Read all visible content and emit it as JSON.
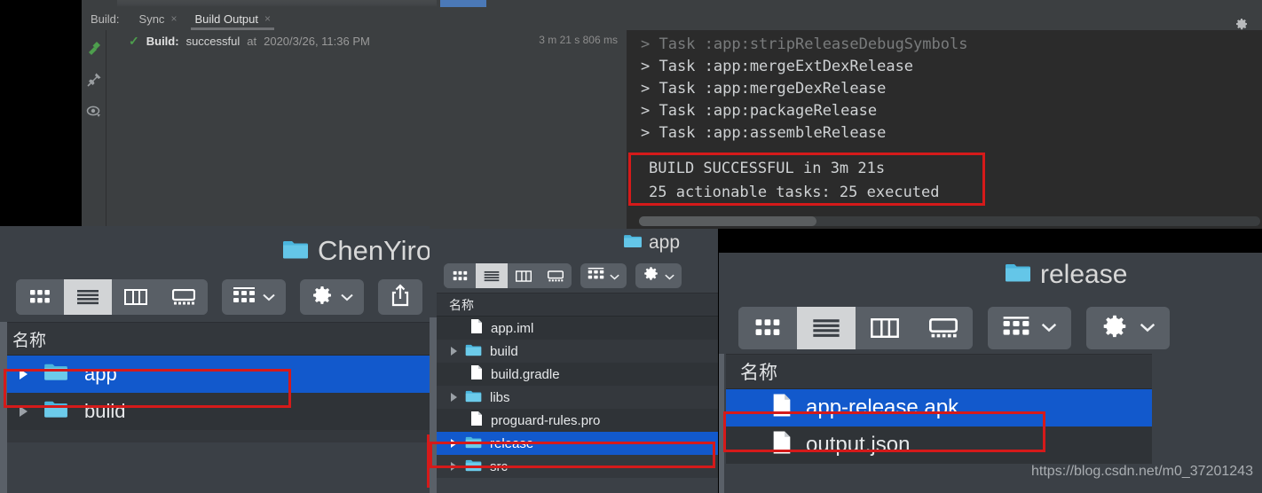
{
  "ide": {
    "tab_group_label": "Build:",
    "tabs": [
      {
        "label": "Sync",
        "close": "×",
        "active": false
      },
      {
        "label": "Build Output",
        "close": "×",
        "active": true
      }
    ],
    "settings_icon": "gear-icon",
    "rail_icons": [
      "restart-hammer-icon",
      "pin-icon",
      "eye-icon"
    ],
    "build_status": {
      "check": "✓",
      "prefix": "Build:",
      "result": "successful",
      "at": "at",
      "timestamp": "2020/3/26, 11:36 PM",
      "duration": "3 m 21 s 806 ms"
    },
    "console_lines": [
      "> Task :app:stripReleaseDebugSymbols",
      "> Task :app:mergeExtDexRelease",
      "> Task :app:mergeDexRelease",
      "> Task :app:packageRelease",
      "> Task :app:assembleRelease"
    ],
    "build_success_lines": [
      "BUILD SUCCESSFUL in 3m 21s",
      "25 actionable tasks: 25 executed"
    ]
  },
  "finder_left": {
    "title": "ChenYirong",
    "folder_icon": "folder-icon",
    "toolbar": {
      "view_icon_grid": "icon-view-icon",
      "view_list": "list-view-icon",
      "view_column": "column-view-icon",
      "view_gallery": "gallery-view-icon",
      "group_icon": "group-by-icon",
      "group_chevron": "chevron-down-icon",
      "action_icon": "gear-icon",
      "action_chevron": "chevron-down-icon",
      "share_icon": "share-icon"
    },
    "column_header": "名称",
    "rows": [
      {
        "name": "app",
        "kind": "folder",
        "expandable": true,
        "selected": true
      },
      {
        "name": "build",
        "kind": "folder",
        "expandable": true,
        "selected": false
      }
    ]
  },
  "finder_mid": {
    "title": "app",
    "folder_icon": "folder-icon",
    "toolbar": {
      "view_icon_grid": "icon-view-icon",
      "view_list": "list-view-icon",
      "view_column": "column-view-icon",
      "view_gallery": "gallery-view-icon",
      "group_icon": "group-by-icon",
      "group_chevron": "chevron-down-icon",
      "action_icon": "gear-icon",
      "action_chevron": "chevron-down-icon"
    },
    "column_header": "名称",
    "rows": [
      {
        "name": "app.iml",
        "kind": "file",
        "expandable": false,
        "selected": false
      },
      {
        "name": "build",
        "kind": "folder",
        "expandable": true,
        "selected": false
      },
      {
        "name": "build.gradle",
        "kind": "file",
        "expandable": false,
        "selected": false
      },
      {
        "name": "libs",
        "kind": "folder",
        "expandable": true,
        "selected": false
      },
      {
        "name": "proguard-rules.pro",
        "kind": "file",
        "expandable": false,
        "selected": false
      },
      {
        "name": "release",
        "kind": "folder",
        "expandable": true,
        "selected": true
      },
      {
        "name": "src",
        "kind": "folder",
        "expandable": true,
        "selected": false
      }
    ]
  },
  "finder_right": {
    "title": "release",
    "folder_icon": "folder-icon",
    "toolbar": {
      "view_icon_grid": "icon-view-icon",
      "view_list": "list-view-icon",
      "view_column": "column-view-icon",
      "view_gallery": "gallery-view-icon",
      "group_icon": "group-by-icon",
      "group_chevron": "chevron-down-icon",
      "action_icon": "gear-icon",
      "action_chevron": "chevron-down-icon"
    },
    "column_header": "名称",
    "rows": [
      {
        "name": "app-release.apk",
        "kind": "file",
        "expandable": false,
        "selected": true
      },
      {
        "name": "output.json",
        "kind": "file",
        "expandable": false,
        "selected": false
      }
    ]
  },
  "watermark": "https://blog.csdn.net/m0_37201243",
  "colors": {
    "selection_blue": "#1259cc",
    "annotation_red": "#d51a1a",
    "folder_blue": "#4db2e0",
    "success_green": "#4d9e4d"
  }
}
